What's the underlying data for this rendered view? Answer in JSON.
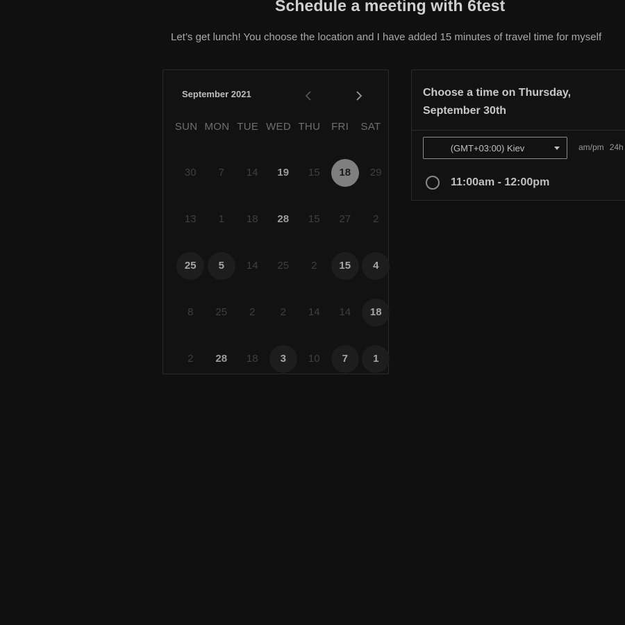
{
  "header": {
    "title": "Schedule a meeting with 6test",
    "description": "Let’s get lunch! You choose the location and I have added 15 minutes of travel time for myself"
  },
  "calendar": {
    "month_label": "September 2021",
    "prev_icon": "chevron-left-icon",
    "next_icon": "chevron-right-icon",
    "weekdays": [
      "SUN",
      "MON",
      "TUE",
      "WED",
      "THU",
      "FRI",
      "SAT"
    ],
    "weeks": [
      [
        {
          "label": "30",
          "state": "disabled"
        },
        {
          "label": "7",
          "state": "disabled"
        },
        {
          "label": "14",
          "state": "disabled"
        },
        {
          "label": "19",
          "state": "active"
        },
        {
          "label": "15",
          "state": "disabled"
        },
        {
          "label": "18",
          "state": "selected"
        },
        {
          "label": "29",
          "state": "disabled"
        }
      ],
      [
        {
          "label": "13",
          "state": "disabled"
        },
        {
          "label": "1",
          "state": "disabled"
        },
        {
          "label": "18",
          "state": "disabled"
        },
        {
          "label": "28",
          "state": "active"
        },
        {
          "label": "15",
          "state": "disabled"
        },
        {
          "label": "27",
          "state": "disabled"
        },
        {
          "label": "2",
          "state": "disabled"
        }
      ],
      [
        {
          "label": "25",
          "state": "available"
        },
        {
          "label": "5",
          "state": "available"
        },
        {
          "label": "14",
          "state": "disabled"
        },
        {
          "label": "25",
          "state": "disabled"
        },
        {
          "label": "2",
          "state": "disabled"
        },
        {
          "label": "15",
          "state": "available"
        },
        {
          "label": "4",
          "state": "available"
        }
      ],
      [
        {
          "label": "8",
          "state": "disabled"
        },
        {
          "label": "25",
          "state": "disabled"
        },
        {
          "label": "2",
          "state": "disabled"
        },
        {
          "label": "2",
          "state": "disabled"
        },
        {
          "label": "14",
          "state": "disabled"
        },
        {
          "label": "14",
          "state": "disabled"
        },
        {
          "label": "18",
          "state": "available"
        }
      ],
      [
        {
          "label": "2",
          "state": "disabled"
        },
        {
          "label": "28",
          "state": "active"
        },
        {
          "label": "18",
          "state": "disabled"
        },
        {
          "label": "3",
          "state": "available"
        },
        {
          "label": "10",
          "state": "disabled"
        },
        {
          "label": "7",
          "state": "available"
        },
        {
          "label": "1",
          "state": "available"
        }
      ]
    ]
  },
  "time_panel": {
    "heading": "Choose a time on Thursday, September 30th",
    "timezone": {
      "selected": "(GMT+03:00) Kiev",
      "icon": "caret-down-icon"
    },
    "format_options": [
      "am/pm",
      "24h"
    ],
    "slots": [
      {
        "label": "11:00am - 12:00pm",
        "selected": false
      }
    ]
  },
  "colors": {
    "background": "#101010",
    "selected_day": "#7f7f7f",
    "available_day": "#1d1d1d",
    "border": "#2a2a2a"
  }
}
